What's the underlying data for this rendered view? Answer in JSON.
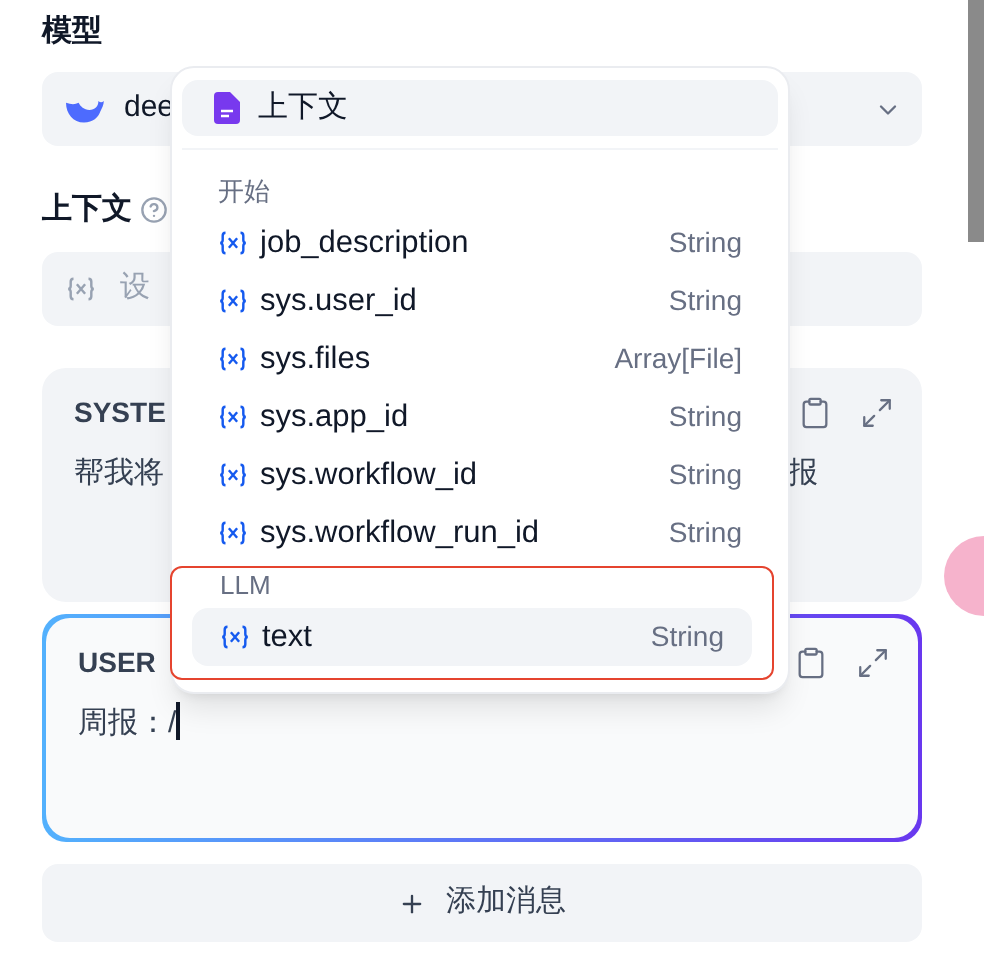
{
  "model": {
    "label": "模型",
    "name": "dee"
  },
  "context": {
    "label": "上下文",
    "placeholder": "设"
  },
  "messages": [
    {
      "role": "SYSTE",
      "text": "帮我将",
      "text_tail": "报",
      "focused": false
    },
    {
      "role": "USER",
      "text": "周报：/",
      "focused": true
    }
  ],
  "add_button": "添加消息",
  "popup": {
    "title": "上下文",
    "groups": [
      {
        "name": "开始",
        "highlighted": false,
        "items": [
          {
            "name": "job_description",
            "type": "String",
            "selected": false
          },
          {
            "name": "sys.user_id",
            "type": "String",
            "selected": false
          },
          {
            "name": "sys.files",
            "type": "Array[File]",
            "selected": false
          },
          {
            "name": "sys.app_id",
            "type": "String",
            "selected": false
          },
          {
            "name": "sys.workflow_id",
            "type": "String",
            "selected": false
          },
          {
            "name": "sys.workflow_run_id",
            "type": "String",
            "selected": false
          }
        ]
      },
      {
        "name": "LLM",
        "highlighted": true,
        "items": [
          {
            "name": "text",
            "type": "String",
            "selected": true
          }
        ]
      }
    ]
  }
}
